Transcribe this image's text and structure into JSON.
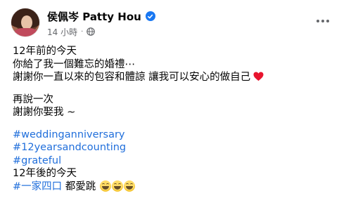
{
  "post": {
    "author": "侯佩岑 Patty Hou",
    "time": "14 小時",
    "separator": "·",
    "visibility_icon": "globe-icon",
    "verified_icon": "verified-badge-icon",
    "more_icon": "more-options-icon",
    "accent_color": "#1877f2",
    "hashtag_color": "#216fdb",
    "lines_block1": [
      "12年前的今天",
      "你給了我一個難忘的婚禮⋯",
      "謝謝你一直以來的包容和體諒 讓我可以安心的做自己"
    ],
    "lines_block2": [
      "再說一次",
      "謝謝你娶我 ~"
    ],
    "hashtags": [
      "#weddinganniversary",
      "#12yearsandcounting",
      "#grateful"
    ],
    "after_hashtags": "12年後的今天",
    "last_tag": "#一家四口",
    "last_text": " 都愛跳 ",
    "heart_emoji": "red-heart",
    "laugh_emoji": "grinning-squinting-face"
  }
}
